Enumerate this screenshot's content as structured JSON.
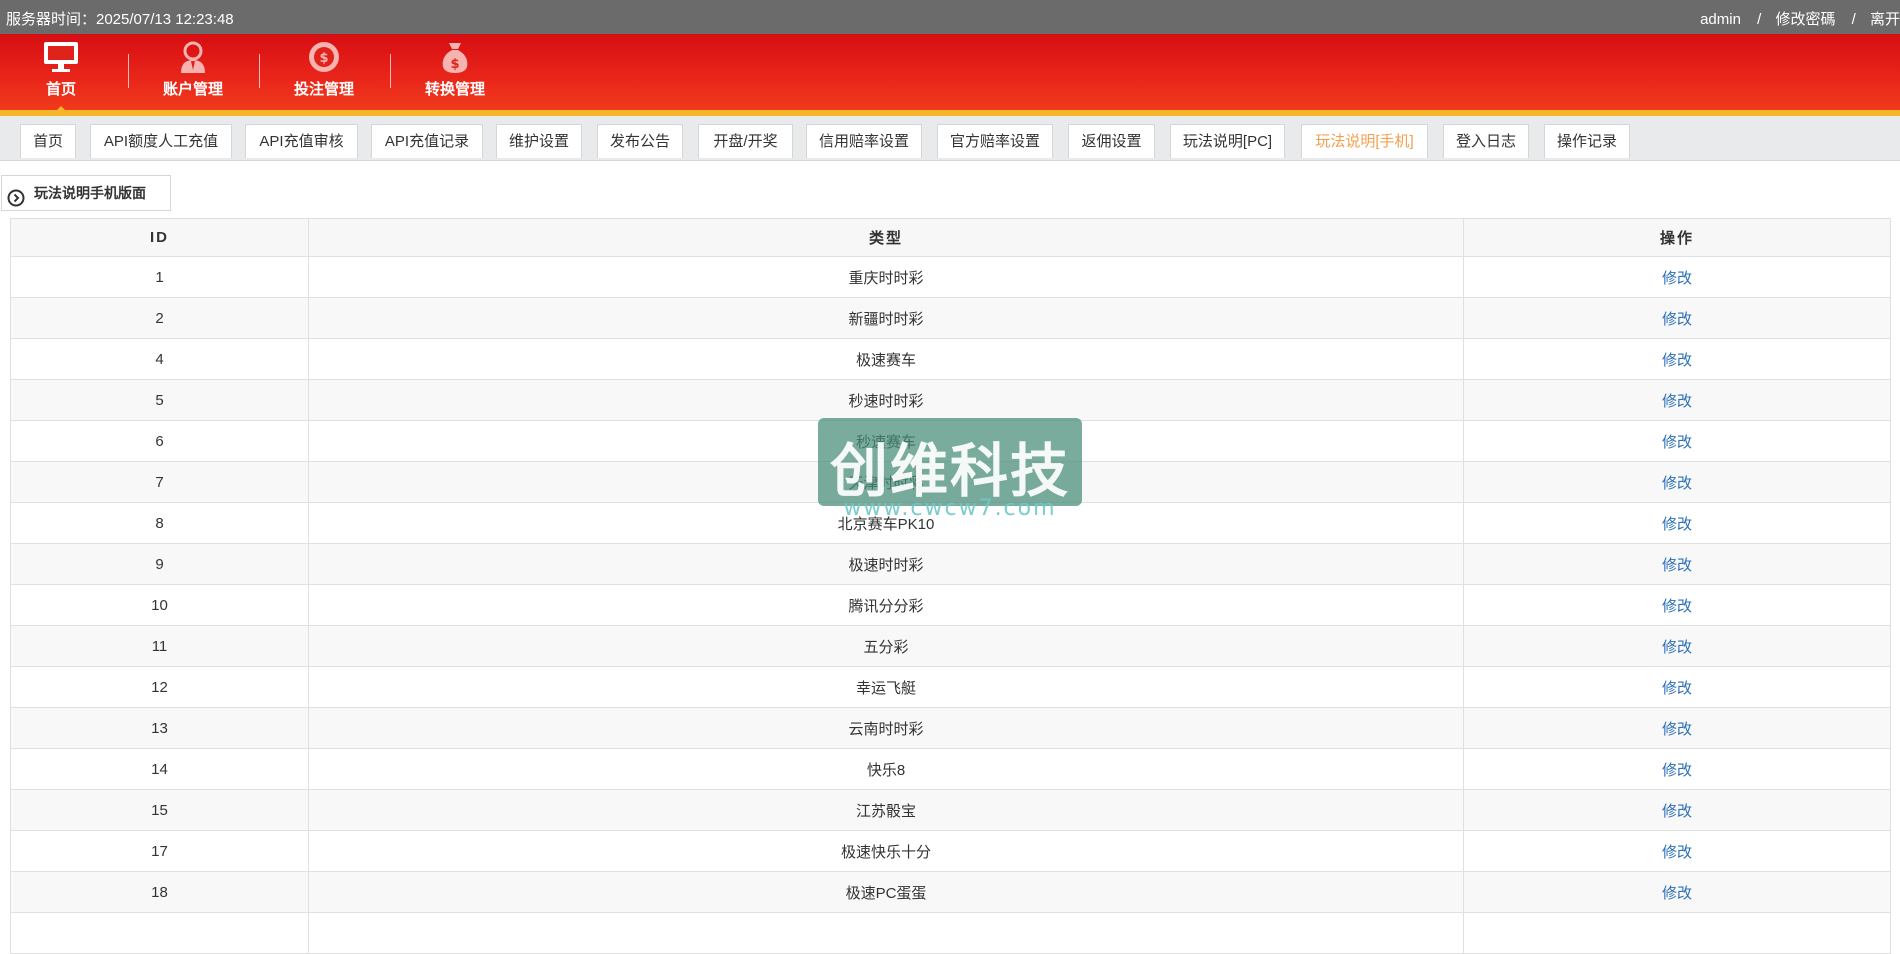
{
  "topbar": {
    "server_time": "服务器时间：2025/07/13 12:23:48",
    "user": "admin",
    "change_password": "修改密碼",
    "logout": "离开"
  },
  "nav": [
    {
      "label": "首页",
      "icon": "monitor-icon",
      "active": true
    },
    {
      "label": "账户管理",
      "icon": "user-icon"
    },
    {
      "label": "投注管理",
      "icon": "chip-icon"
    },
    {
      "label": "转换管理",
      "icon": "money-bag-icon"
    }
  ],
  "tabs": [
    {
      "label": "首页"
    },
    {
      "label": "API额度人工充值"
    },
    {
      "label": "API充值审核"
    },
    {
      "label": "API充值记录"
    },
    {
      "label": "维护设置"
    },
    {
      "label": "发布公告"
    },
    {
      "label": "开盘/开奖"
    },
    {
      "label": "信用赔率设置"
    },
    {
      "label": "官方赔率设置"
    },
    {
      "label": "返佣设置"
    },
    {
      "label": "玩法说明[PC]"
    },
    {
      "label": "玩法说明[手机]",
      "active": true
    },
    {
      "label": "登入日志"
    },
    {
      "label": "操作记录"
    }
  ],
  "section": {
    "title": "玩法说明手机版面",
    "icon": "circle-arrow-icon"
  },
  "table": {
    "headers": [
      "ID",
      "类型",
      "操作"
    ],
    "rows": [
      {
        "id": "1",
        "type": "重庆时时彩",
        "action": "修改"
      },
      {
        "id": "2",
        "type": "新疆时时彩",
        "action": "修改"
      },
      {
        "id": "4",
        "type": "极速赛车",
        "action": "修改"
      },
      {
        "id": "5",
        "type": "秒速时时彩",
        "action": "修改"
      },
      {
        "id": "6",
        "type": "秒速赛车",
        "action": "修改"
      },
      {
        "id": "7",
        "type": "天津时时彩",
        "action": "修改"
      },
      {
        "id": "8",
        "type": "北京赛车PK10",
        "action": "修改"
      },
      {
        "id": "9",
        "type": "极速时时彩",
        "action": "修改"
      },
      {
        "id": "10",
        "type": "腾讯分分彩",
        "action": "修改"
      },
      {
        "id": "11",
        "type": "五分彩",
        "action": "修改"
      },
      {
        "id": "12",
        "type": "幸运飞艇",
        "action": "修改"
      },
      {
        "id": "13",
        "type": "云南时时彩",
        "action": "修改"
      },
      {
        "id": "14",
        "type": "快乐8",
        "action": "修改"
      },
      {
        "id": "15",
        "type": "江苏骰宝",
        "action": "修改"
      },
      {
        "id": "17",
        "type": "极速快乐十分",
        "action": "修改"
      },
      {
        "id": "18",
        "type": "极速PC蛋蛋",
        "action": "修改"
      },
      {
        "id": "",
        "type": "",
        "action": ""
      }
    ]
  },
  "watermark": {
    "main": "创维科技",
    "sub": "www.cwcw7.com"
  },
  "colors": {
    "topbar": "#6b6b6b",
    "header_red": "#e8241a",
    "header_accent": "#f4b52a",
    "active_tab": "#f0a050",
    "link": "#2a6fb8"
  }
}
